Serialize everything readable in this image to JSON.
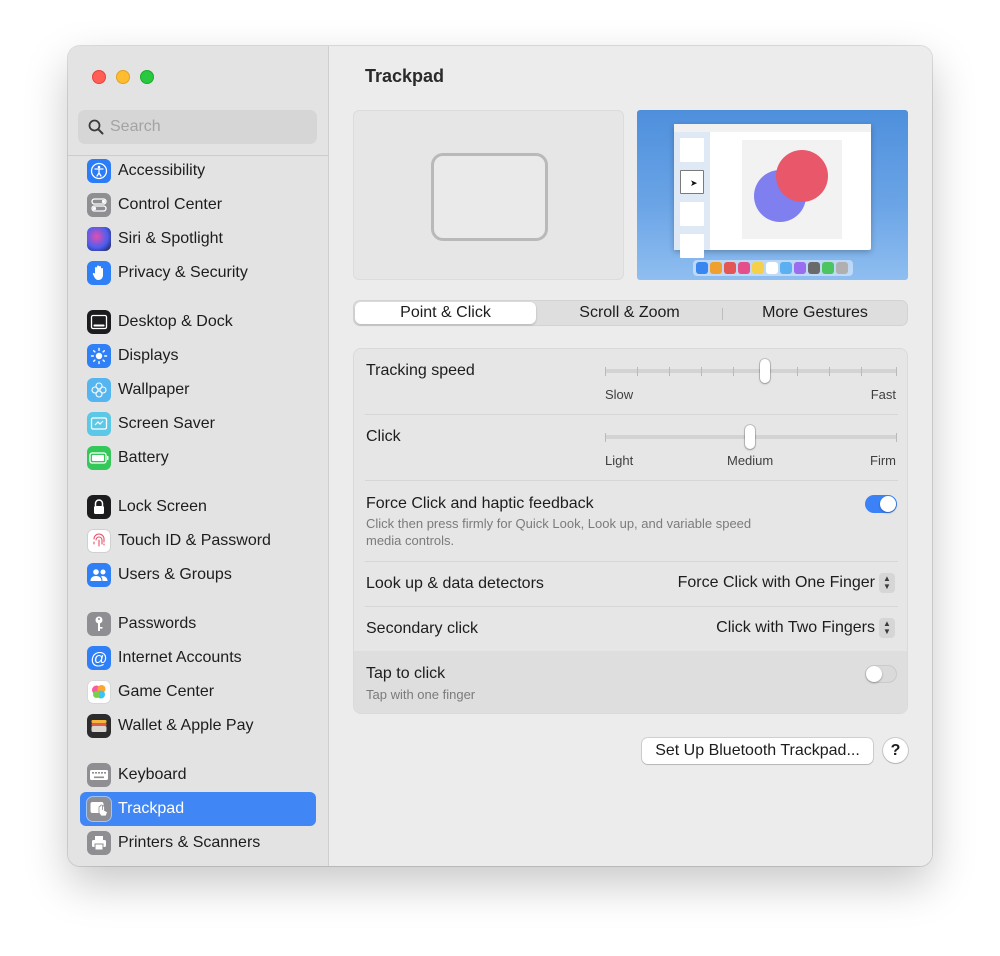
{
  "window": {
    "traffic_lights": [
      "close",
      "minimize",
      "zoom"
    ]
  },
  "search": {
    "placeholder": "Search",
    "value": ""
  },
  "sidebar": {
    "items": [
      {
        "label": "Accessibility",
        "icon": "accessibility-icon",
        "color": "#2b7cf6"
      },
      {
        "label": "Control Center",
        "icon": "control-center-icon",
        "color": "#8e8e93"
      },
      {
        "label": "Siri & Spotlight",
        "icon": "siri-icon",
        "color": "#3d3a66"
      },
      {
        "label": "Privacy & Security",
        "icon": "hand-icon",
        "color": "#2f80f7"
      },
      {
        "label": "Desktop & Dock",
        "icon": "desktop-dock-icon",
        "color": "#1c1c1e"
      },
      {
        "label": "Displays",
        "icon": "sun-icon",
        "color": "#2f80f7"
      },
      {
        "label": "Wallpaper",
        "icon": "wallpaper-icon",
        "color": "#54b5f0"
      },
      {
        "label": "Screen Saver",
        "icon": "screen-saver-icon",
        "color": "#5ac8e6"
      },
      {
        "label": "Battery",
        "icon": "battery-icon",
        "color": "#34c759"
      },
      {
        "label": "Lock Screen",
        "icon": "lock-icon",
        "color": "#1c1c1e"
      },
      {
        "label": "Touch ID & Password",
        "icon": "fingerprint-icon",
        "color": "#ffffff"
      },
      {
        "label": "Users & Groups",
        "icon": "users-icon",
        "color": "#2f80f7"
      },
      {
        "label": "Passwords",
        "icon": "key-icon",
        "color": "#8e8e93"
      },
      {
        "label": "Internet Accounts",
        "icon": "at-icon",
        "color": "#2f80f7"
      },
      {
        "label": "Game Center",
        "icon": "game-center-icon",
        "color": "#ffffff"
      },
      {
        "label": "Wallet & Apple Pay",
        "icon": "wallet-icon",
        "color": "#2c2c2e"
      },
      {
        "label": "Keyboard",
        "icon": "keyboard-icon",
        "color": "#8e8e93"
      },
      {
        "label": "Trackpad",
        "icon": "trackpad-icon",
        "color": "#8e8e93",
        "selected": true
      },
      {
        "label": "Printers & Scanners",
        "icon": "printer-icon",
        "color": "#8e8e93"
      }
    ]
  },
  "main": {
    "title": "Trackpad",
    "tabs": [
      {
        "label": "Point & Click",
        "active": true
      },
      {
        "label": "Scroll & Zoom",
        "active": false
      },
      {
        "label": "More Gestures",
        "active": false
      }
    ],
    "tracking_speed": {
      "label": "Tracking speed",
      "min_label": "Slow",
      "max_label": "Fast",
      "value_fraction": 0.55
    },
    "click": {
      "label": "Click",
      "min_label": "Light",
      "mid_label": "Medium",
      "max_label": "Firm",
      "value_fraction": 0.5
    },
    "force_click": {
      "label": "Force Click and haptic feedback",
      "description_line1": "Click then press firmly for Quick Look, Look up, and variable speed",
      "description_line2": "media controls.",
      "enabled": true
    },
    "look_up": {
      "label": "Look up & data detectors",
      "value": "Force Click with One Finger"
    },
    "secondary_click": {
      "label": "Secondary click",
      "value": "Click with Two Fingers"
    },
    "tap_to_click": {
      "label": "Tap to click",
      "description": "Tap with one finger",
      "enabled": false
    },
    "setup_button": "Set Up Bluetooth Trackpad...",
    "help_button": "?"
  }
}
